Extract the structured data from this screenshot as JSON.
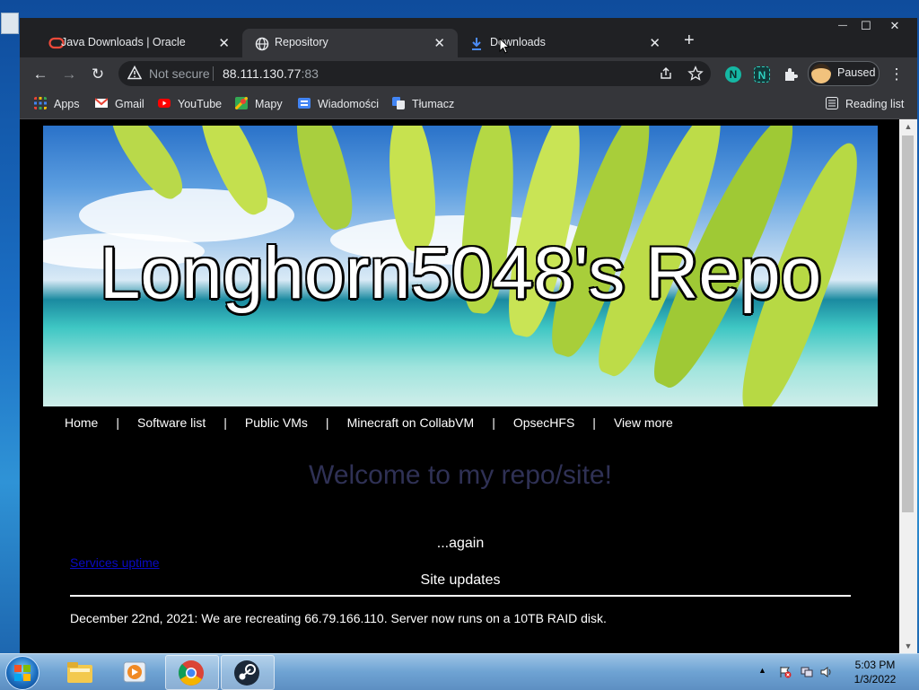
{
  "tabs": [
    {
      "title": "Java Downloads | Oracle",
      "close": "✕"
    },
    {
      "title": "Repository",
      "close": "✕"
    },
    {
      "title": "Downloads",
      "close": "✕"
    }
  ],
  "new_tab": "+",
  "window_controls": {
    "minimize": "—",
    "maximize": "☐",
    "close": "✕"
  },
  "toolbar": {
    "back": "←",
    "forward": "→",
    "reload": "↻",
    "security_label": "Not secure",
    "url_host": "88.111.130.77",
    "url_port": ":83",
    "profile_label": "Paused",
    "menu": "⋮"
  },
  "bookmarks": [
    {
      "label": "Apps"
    },
    {
      "label": "Gmail"
    },
    {
      "label": "YouTube"
    },
    {
      "label": "Mapy"
    },
    {
      "label": "Wiadomości"
    },
    {
      "label": "Tłumacz"
    }
  ],
  "reading_list": "Reading list",
  "page": {
    "hero_title": "Longhorn5048's Repo",
    "nav": [
      "Home",
      "Software list",
      "Public VMs",
      "Minecraft on CollabVM",
      "OpsecHFS",
      "View more"
    ],
    "nav_separator": "|",
    "welcome": "Welcome to my repo/site!",
    "again": "...again",
    "uptime_link": "Services uptime",
    "site_updates": "Site updates",
    "news": "December 22nd, 2021: We are recreating 66.79.166.110. Server now runs on a 10TB RAID disk."
  },
  "taskbar": {
    "time": "5:03 PM",
    "date": "1/3/2022"
  },
  "colors": {
    "chrome_bg": "#202124",
    "chrome_toolbar": "#35363a",
    "welcome_text": "#2f3155",
    "link": "#0a0ac4"
  }
}
